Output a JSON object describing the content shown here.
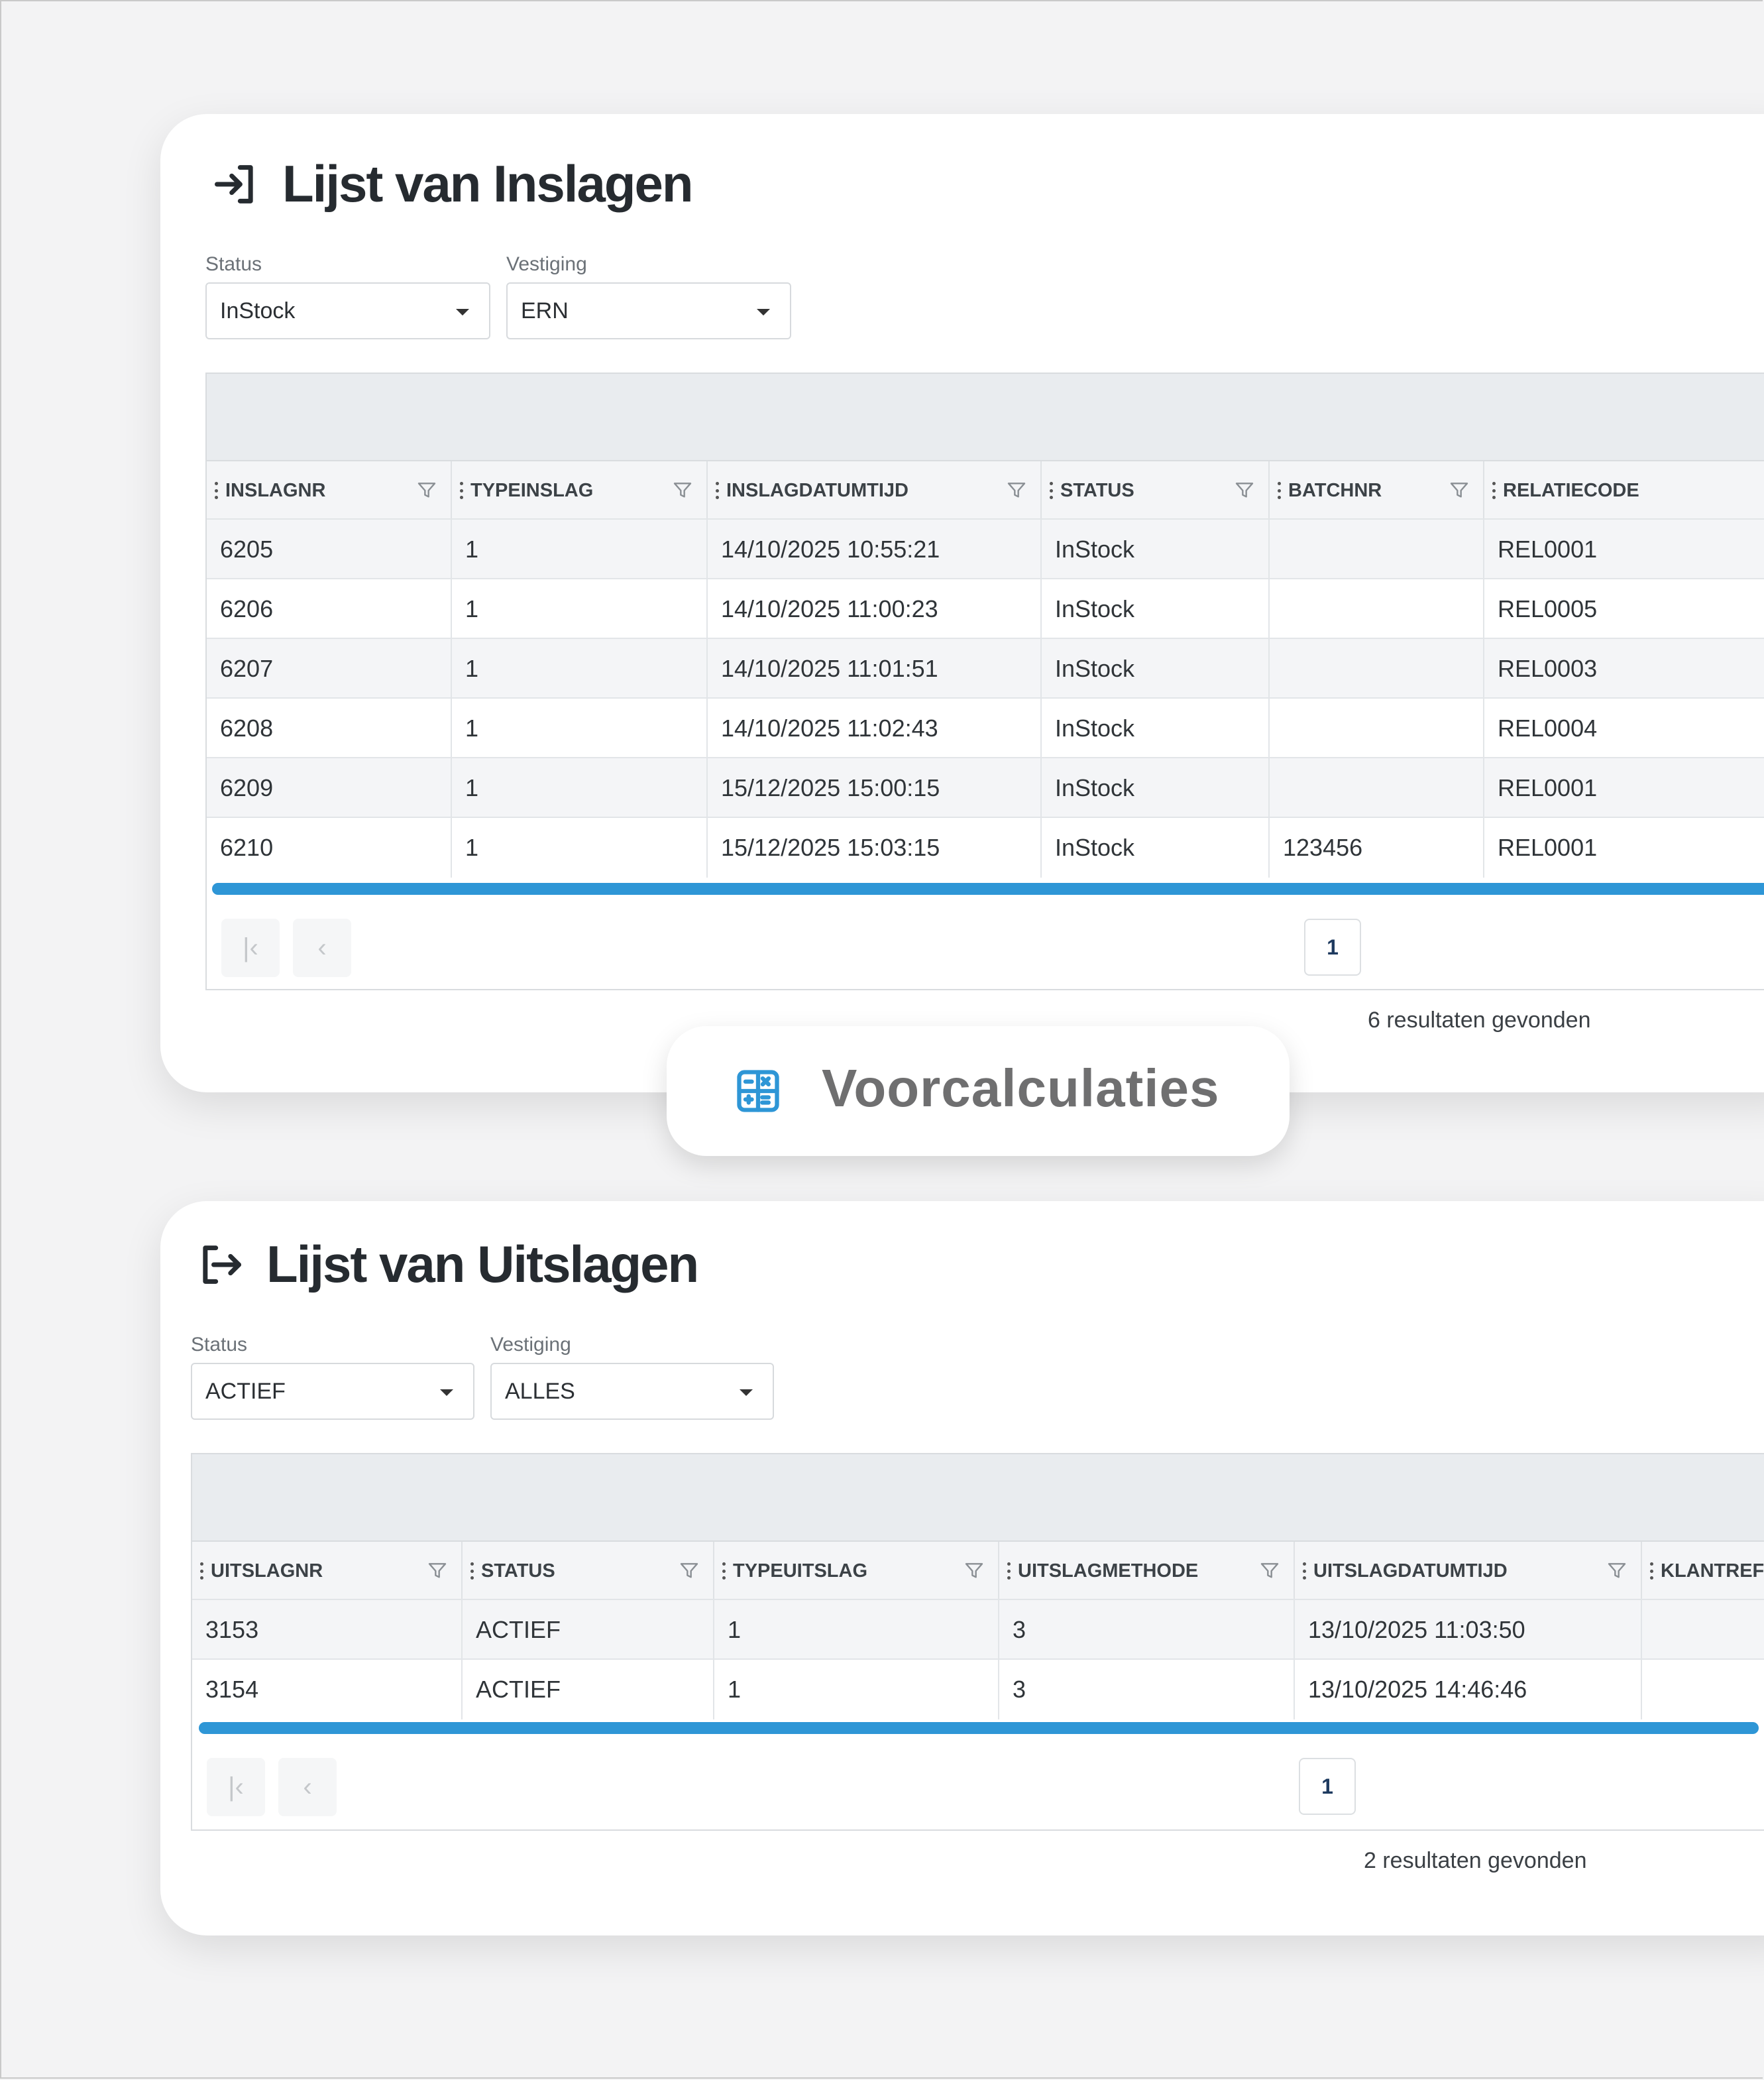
{
  "inslagen": {
    "title": "Lijst van Inslagen",
    "status_label": "Status",
    "status_value": "InStock",
    "vestiging_label": "Vestiging",
    "vestiging_value": "ERN",
    "columns": [
      "INSLAGNR",
      "TYPEINSLAG",
      "INSLAGDATUMTIJD",
      "STATUS",
      "BATCHNR",
      "RELATIECODE"
    ],
    "rows": [
      [
        "6205",
        "1",
        "14/10/2025 10:55:21",
        "InStock",
        "",
        "REL0001"
      ],
      [
        "6206",
        "1",
        "14/10/2025 11:00:23",
        "InStock",
        "",
        "REL0005"
      ],
      [
        "6207",
        "1",
        "14/10/2025 11:01:51",
        "InStock",
        "",
        "REL0003"
      ],
      [
        "6208",
        "1",
        "14/10/2025 11:02:43",
        "InStock",
        "",
        "REL0004"
      ],
      [
        "6209",
        "1",
        "15/12/2025 15:00:15",
        "InStock",
        "",
        "REL0001"
      ],
      [
        "6210",
        "1",
        "15/12/2025 15:03:15",
        "InStock",
        "123456",
        "REL0001"
      ]
    ],
    "page": "1",
    "results": "6 resultaten gevonden"
  },
  "badge": {
    "label": "Voorcalculaties",
    "icon": "calculator-icon"
  },
  "uitslagen": {
    "title": "Lijst van Uitslagen",
    "status_label": "Status",
    "status_value": "ACTIEF",
    "vestiging_label": "Vestiging",
    "vestiging_value": "ALLES",
    "columns": [
      "UITSLAGNR",
      "STATUS",
      "TYPEUITSLAG",
      "UITSLAGMETHODE",
      "UITSLAGDATUMTIJD",
      "KLANTREF"
    ],
    "rows": [
      [
        "3153",
        "ACTIEF",
        "1",
        "3",
        "13/10/2025 11:03:50",
        ""
      ],
      [
        "3154",
        "ACTIEF",
        "1",
        "3",
        "13/10/2025 14:46:46",
        ""
      ]
    ],
    "page": "1",
    "results": "2 resultaten gevonden"
  },
  "colors": {
    "accent": "#2e96d6",
    "header_bg": "#e9ecef"
  }
}
